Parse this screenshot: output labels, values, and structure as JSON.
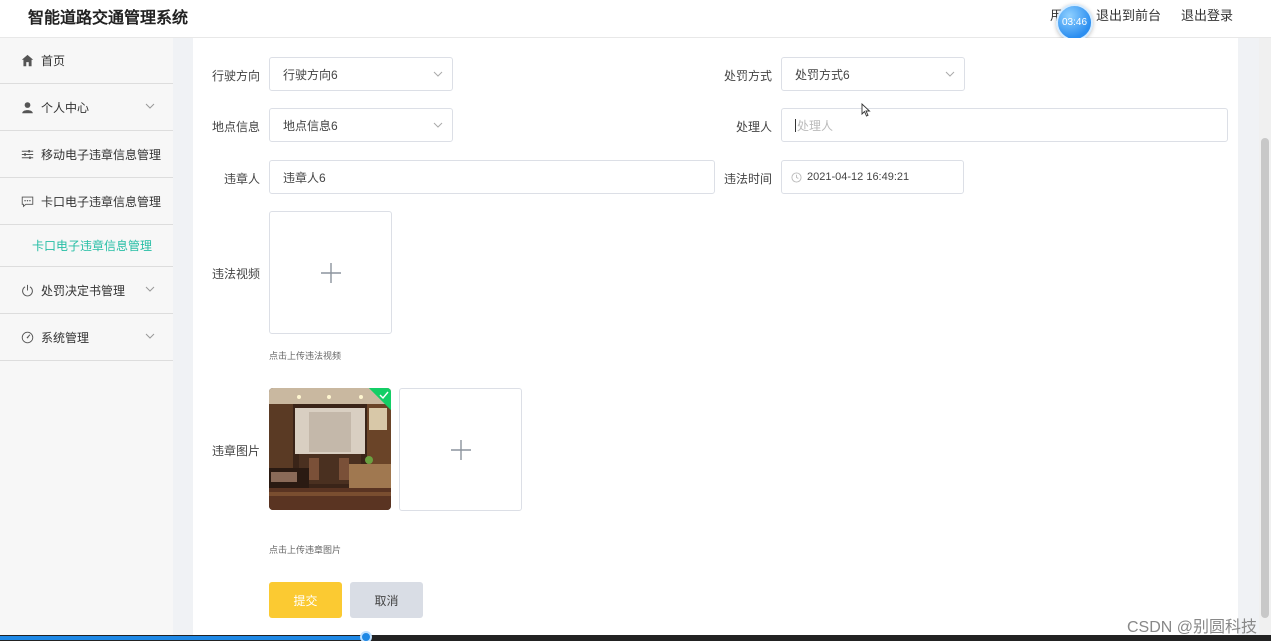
{
  "header": {
    "title": "智能道路交通管理系统",
    "user_label": "用户",
    "back_to_front": "退出到前台",
    "logout": "退出登录",
    "timer": "03:46"
  },
  "sidebar": {
    "items": [
      {
        "label": "首页",
        "icon": "home-icon"
      },
      {
        "label": "个人中心",
        "icon": "user-icon"
      },
      {
        "label": "移动电子违章信息管理",
        "icon": "sliders-icon"
      },
      {
        "label": "卡口电子违章信息管理",
        "icon": "chat-icon"
      },
      {
        "label": "卡口电子违章信息管理",
        "icon": "none",
        "active": true
      },
      {
        "label": "处罚决定书管理",
        "icon": "power-icon"
      },
      {
        "label": "系统管理",
        "icon": "gauge-icon"
      }
    ]
  },
  "form": {
    "direction_label": "行驶方向",
    "direction_value": "行驶方向6",
    "penalty_label": "处罚方式",
    "penalty_value": "处罚方式6",
    "location_label": "地点信息",
    "location_value": "地点信息6",
    "handler_label": "处理人",
    "handler_placeholder": "处理人",
    "violator_label": "违章人",
    "violator_value": "违章人6",
    "time_label": "违法时间",
    "time_value": "2021-04-12 16:49:21",
    "video_label": "违法视频",
    "video_tip": "点击上传违法视频",
    "image_label": "违章图片",
    "image_tip": "点击上传违章图片",
    "submit": "提交",
    "cancel": "取消"
  },
  "colors": {
    "accent": "#26bea5",
    "submit": "#fbca32",
    "cancel": "#d9dde5",
    "success": "#13ce66"
  },
  "video": {
    "progress": 0.288
  },
  "watermark": "CSDN @别圆科技"
}
